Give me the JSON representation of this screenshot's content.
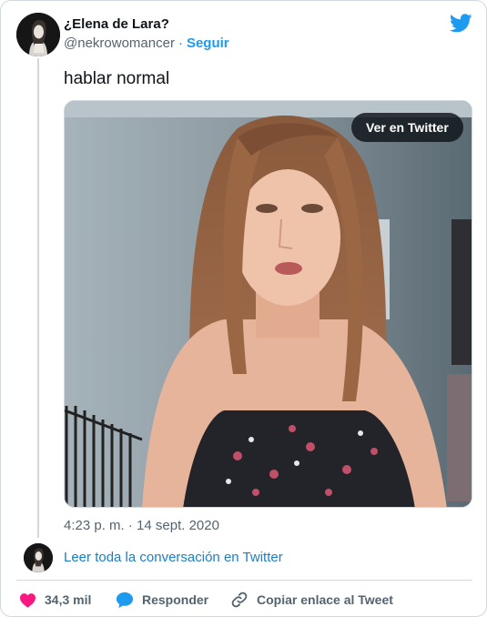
{
  "author": {
    "name": "¿Elena de Lara?",
    "handle": "@nekrowomancer",
    "separator": "·",
    "follow_label": "Seguir"
  },
  "tweet": {
    "text": "hablar normal",
    "timestamp": "4:23 p. m. · 14 sept. 2020"
  },
  "media": {
    "type": "video",
    "watch_label": "Ver en Twitter"
  },
  "thread": {
    "read_conversation_label": "Leer toda la conversación en Twitter"
  },
  "actions": {
    "likes_count": "34,3 mil",
    "reply_label": "Responder",
    "copy_link_label": "Copiar enlace al Tweet"
  },
  "colors": {
    "accent": "#1d9bf0",
    "like": "#f91880",
    "text_secondary": "#536471",
    "border": "#cfd9de"
  },
  "icons": {
    "brand": "twitter-bird-icon",
    "like": "heart-icon",
    "reply": "speech-bubble-icon",
    "copy": "link-icon"
  }
}
